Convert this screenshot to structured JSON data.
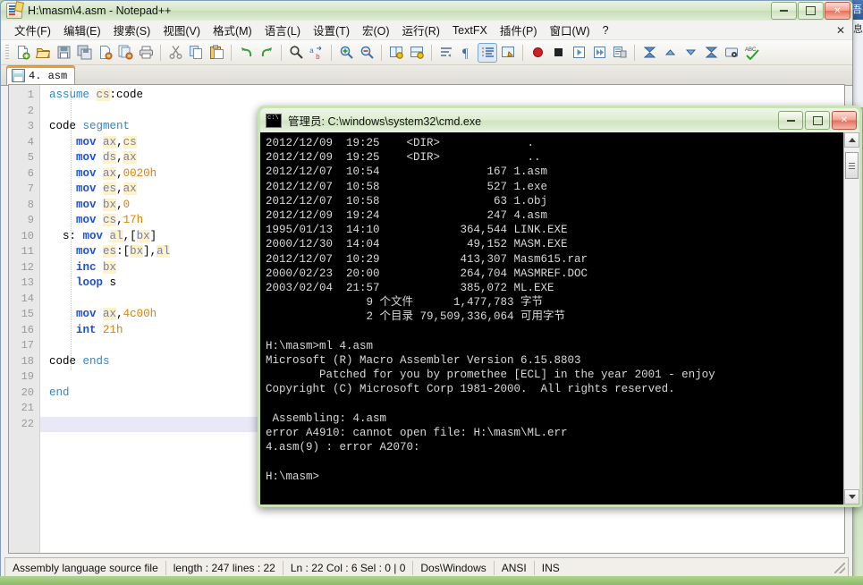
{
  "desktop": {
    "bg_window": {
      "title": "吾",
      "body": "息"
    }
  },
  "notepadpp": {
    "title": "H:\\masm\\4.asm - Notepad++",
    "icon": "notepadpp-icon",
    "window_buttons": {
      "minimize": "—",
      "maximize": "▫",
      "close": "✕"
    },
    "menu": [
      {
        "label": "文件(F)",
        "name": "menu-file"
      },
      {
        "label": "编辑(E)",
        "name": "menu-edit"
      },
      {
        "label": "搜索(S)",
        "name": "menu-search"
      },
      {
        "label": "视图(V)",
        "name": "menu-view"
      },
      {
        "label": "格式(M)",
        "name": "menu-format"
      },
      {
        "label": "语言(L)",
        "name": "menu-language"
      },
      {
        "label": "设置(T)",
        "name": "menu-settings"
      },
      {
        "label": "宏(O)",
        "name": "menu-macro"
      },
      {
        "label": "运行(R)",
        "name": "menu-run"
      },
      {
        "label": "TextFX",
        "name": "menu-textfx"
      },
      {
        "label": "插件(P)",
        "name": "menu-plugins"
      },
      {
        "label": "窗口(W)",
        "name": "menu-window"
      },
      {
        "label": "?",
        "name": "menu-help"
      }
    ],
    "menu_close_label": "✕",
    "toolbar": [
      "new-file-icon",
      "open-file-icon",
      "save-icon",
      "save-all-icon",
      "close-file-icon",
      "close-all-icon",
      "print-icon",
      "sep",
      "cut-icon",
      "copy-icon",
      "paste-icon",
      "sep",
      "undo-icon",
      "redo-icon",
      "sep",
      "find-icon",
      "replace-replace-icon",
      "sep",
      "zoom-in-icon",
      "zoom-out-icon",
      "sep",
      "sync-vertical-scroll-icon",
      "sync-horizontal-scroll-icon",
      "sep",
      "word-wrap-icon",
      "show-all-chars-icon",
      "indent-guide-icon",
      "user-defined-dialog-icon",
      "sep",
      "record-macro-icon",
      "stop-record-macro-icon",
      "play-macro-icon",
      "run-macro-multiple-icon",
      "save-macro-icon",
      "sep",
      "collapse-all-icon",
      "collapse-level-icon",
      "expand-level-icon",
      "expand-all-icon",
      "run-icon",
      "spellcheck-icon"
    ],
    "tab": {
      "label": "4. asm",
      "icon": "saved-file-icon"
    },
    "editor": {
      "line_count": 22,
      "current_line": 22,
      "lines": [
        {
          "n": 1,
          "tokens": [
            {
              "t": "assume",
              "c": "dir"
            },
            {
              "t": " ",
              "c": "pln"
            },
            {
              "t": "cs",
              "c": "reg"
            },
            {
              "t": ":code",
              "c": "pln"
            }
          ]
        },
        {
          "n": 2,
          "tokens": []
        },
        {
          "n": 3,
          "tokens": [
            {
              "t": "code ",
              "c": "pln"
            },
            {
              "t": "segment",
              "c": "dir"
            }
          ]
        },
        {
          "n": 4,
          "tokens": [
            {
              "t": "    ",
              "c": "pln"
            },
            {
              "t": "mov",
              "c": "kw"
            },
            {
              "t": " ",
              "c": "pln"
            },
            {
              "t": "ax",
              "c": "reg"
            },
            {
              "t": ",",
              "c": "pln"
            },
            {
              "t": "cs",
              "c": "reg"
            }
          ]
        },
        {
          "n": 5,
          "tokens": [
            {
              "t": "    ",
              "c": "pln"
            },
            {
              "t": "mov",
              "c": "kw"
            },
            {
              "t": " ",
              "c": "pln"
            },
            {
              "t": "ds",
              "c": "reg"
            },
            {
              "t": ",",
              "c": "pln"
            },
            {
              "t": "ax",
              "c": "reg"
            }
          ]
        },
        {
          "n": 6,
          "tokens": [
            {
              "t": "    ",
              "c": "pln"
            },
            {
              "t": "mov",
              "c": "kw"
            },
            {
              "t": " ",
              "c": "pln"
            },
            {
              "t": "ax",
              "c": "reg"
            },
            {
              "t": ",",
              "c": "pln"
            },
            {
              "t": "0020h",
              "c": "num"
            }
          ]
        },
        {
          "n": 7,
          "tokens": [
            {
              "t": "    ",
              "c": "pln"
            },
            {
              "t": "mov",
              "c": "kw"
            },
            {
              "t": " ",
              "c": "pln"
            },
            {
              "t": "es",
              "c": "reg"
            },
            {
              "t": ",",
              "c": "pln"
            },
            {
              "t": "ax",
              "c": "reg"
            }
          ]
        },
        {
          "n": 8,
          "tokens": [
            {
              "t": "    ",
              "c": "pln"
            },
            {
              "t": "mov",
              "c": "kw"
            },
            {
              "t": " ",
              "c": "pln"
            },
            {
              "t": "bx",
              "c": "reg"
            },
            {
              "t": ",",
              "c": "pln"
            },
            {
              "t": "0",
              "c": "num"
            }
          ]
        },
        {
          "n": 9,
          "tokens": [
            {
              "t": "    ",
              "c": "pln"
            },
            {
              "t": "mov",
              "c": "kw"
            },
            {
              "t": " ",
              "c": "pln"
            },
            {
              "t": "cs",
              "c": "reg"
            },
            {
              "t": ",",
              "c": "pln"
            },
            {
              "t": "17h",
              "c": "num"
            }
          ]
        },
        {
          "n": 10,
          "tokens": [
            {
              "t": "  s: ",
              "c": "pln"
            },
            {
              "t": "mov",
              "c": "kw"
            },
            {
              "t": " ",
              "c": "pln"
            },
            {
              "t": "al",
              "c": "reg"
            },
            {
              "t": ",[",
              "c": "pln"
            },
            {
              "t": "bx",
              "c": "reg"
            },
            {
              "t": "]",
              "c": "pln"
            }
          ]
        },
        {
          "n": 11,
          "tokens": [
            {
              "t": "    ",
              "c": "pln"
            },
            {
              "t": "mov",
              "c": "kw"
            },
            {
              "t": " ",
              "c": "pln"
            },
            {
              "t": "es",
              "c": "reg"
            },
            {
              "t": ":[",
              "c": "pln"
            },
            {
              "t": "bx",
              "c": "reg"
            },
            {
              "t": "],",
              "c": "pln"
            },
            {
              "t": "al",
              "c": "reg"
            }
          ]
        },
        {
          "n": 12,
          "tokens": [
            {
              "t": "    ",
              "c": "pln"
            },
            {
              "t": "inc",
              "c": "kw"
            },
            {
              "t": " ",
              "c": "pln"
            },
            {
              "t": "bx",
              "c": "reg"
            }
          ]
        },
        {
          "n": 13,
          "tokens": [
            {
              "t": "    ",
              "c": "pln"
            },
            {
              "t": "loop",
              "c": "kw"
            },
            {
              "t": " s",
              "c": "pln"
            }
          ]
        },
        {
          "n": 14,
          "tokens": []
        },
        {
          "n": 15,
          "tokens": [
            {
              "t": "    ",
              "c": "pln"
            },
            {
              "t": "mov",
              "c": "kw"
            },
            {
              "t": " ",
              "c": "pln"
            },
            {
              "t": "ax",
              "c": "reg"
            },
            {
              "t": ",",
              "c": "pln"
            },
            {
              "t": "4c00h",
              "c": "num"
            }
          ]
        },
        {
          "n": 16,
          "tokens": [
            {
              "t": "    ",
              "c": "pln"
            },
            {
              "t": "int",
              "c": "kw"
            },
            {
              "t": " ",
              "c": "pln"
            },
            {
              "t": "21h",
              "c": "num"
            }
          ]
        },
        {
          "n": 17,
          "tokens": []
        },
        {
          "n": 18,
          "tokens": [
            {
              "t": "code ",
              "c": "pln"
            },
            {
              "t": "ends",
              "c": "dir"
            }
          ]
        },
        {
          "n": 19,
          "tokens": []
        },
        {
          "n": 20,
          "tokens": [
            {
              "t": "end",
              "c": "dir"
            }
          ]
        },
        {
          "n": 21,
          "tokens": []
        },
        {
          "n": 22,
          "tokens": []
        }
      ]
    },
    "statusbar": {
      "file_type": "Assembly language source file",
      "length_lines": "length : 247    lines : 22",
      "caret": "Ln : 22    Col : 6    Sel : 0 | 0",
      "eol": "Dos\\Windows",
      "encoding": "ANSI",
      "insert_mode": "INS"
    }
  },
  "cmd": {
    "title": "管理员: C:\\windows\\system32\\cmd.exe",
    "icon": "console-icon",
    "window_buttons": {
      "minimize": "—",
      "maximize": "▫",
      "close": "✕"
    },
    "output": "2012/12/09  19:25    <DIR>             .\n2012/12/09  19:25    <DIR>             ..\n2012/12/07  10:54                167 1.asm\n2012/12/07  10:58                527 1.exe\n2012/12/07  10:58                 63 1.obj\n2012/12/09  19:24                247 4.asm\n1995/01/13  14:10            364,544 LINK.EXE\n2000/12/30  14:04             49,152 MASM.EXE\n2012/12/07  10:29            413,307 Masm615.rar\n2000/02/23  20:00            264,704 MASMREF.DOC\n2003/02/04  21:57            385,072 ML.EXE\n               9 个文件      1,477,783 字节\n               2 个目录 79,509,336,064 可用字节\n\nH:\\masm>ml 4.asm\nMicrosoft (R) Macro Assembler Version 6.15.8803\n        Patched for you by promethee [ECL] in the year 2001 - enjoy\nCopyright (C) Microsoft Corp 1981-2000.  All rights reserved.\n\n Assembling: 4.asm\nerror A4910: cannot open file: H:\\masm\\ML.err\n4.asm(9) : error A2070:\n\nH:\\masm>",
    "scrollbar": {
      "up": "▲",
      "down": "▼"
    }
  }
}
